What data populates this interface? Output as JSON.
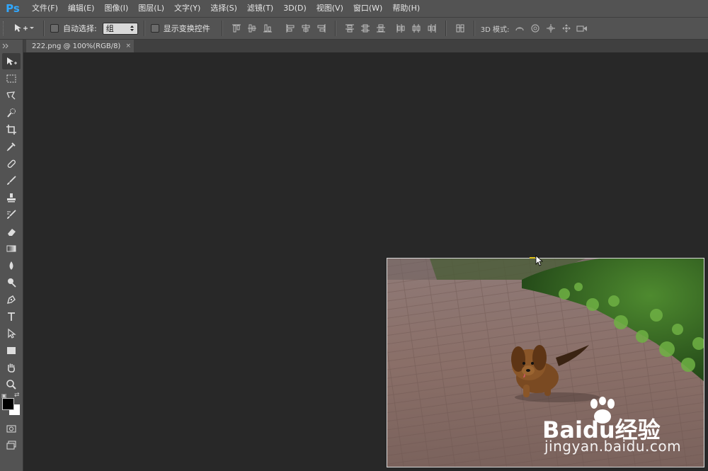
{
  "app": {
    "logo_text": "Ps",
    "brand_color": "#31a8ff"
  },
  "menu": {
    "items": [
      "文件(F)",
      "编辑(E)",
      "图像(I)",
      "图层(L)",
      "文字(Y)",
      "选择(S)",
      "滤镜(T)",
      "3D(D)",
      "视图(V)",
      "窗口(W)",
      "帮助(H)"
    ]
  },
  "options": {
    "auto_select_label": "自动选择:",
    "auto_select_checked": false,
    "auto_select_value": "组",
    "show_transform_label": "显示变换控件",
    "show_transform_checked": false,
    "mode3d_label": "3D 模式:"
  },
  "document": {
    "tab_title": "222.png @ 100%(RGB/8)",
    "close_glyph": "×"
  },
  "tools": [
    "move-tool-icon",
    "marquee-tool-icon",
    "lasso-tool-icon",
    "quick-selection-tool-icon",
    "crop-tool-icon",
    "eyedropper-tool-icon",
    "spot-healing-tool-icon",
    "brush-tool-icon",
    "clone-stamp-tool-icon",
    "history-brush-tool-icon",
    "eraser-tool-icon",
    "gradient-tool-icon",
    "blur-tool-icon",
    "dodge-tool-icon",
    "pen-tool-icon",
    "type-tool-icon",
    "path-selection-tool-icon",
    "rectangle-tool-icon",
    "hand-tool-icon",
    "zoom-tool-icon"
  ],
  "colors": {
    "foreground": "#000000",
    "background": "#ffffff"
  },
  "watermark": {
    "logo": "Baidu经验",
    "url": "jingyan.baidu.com"
  }
}
